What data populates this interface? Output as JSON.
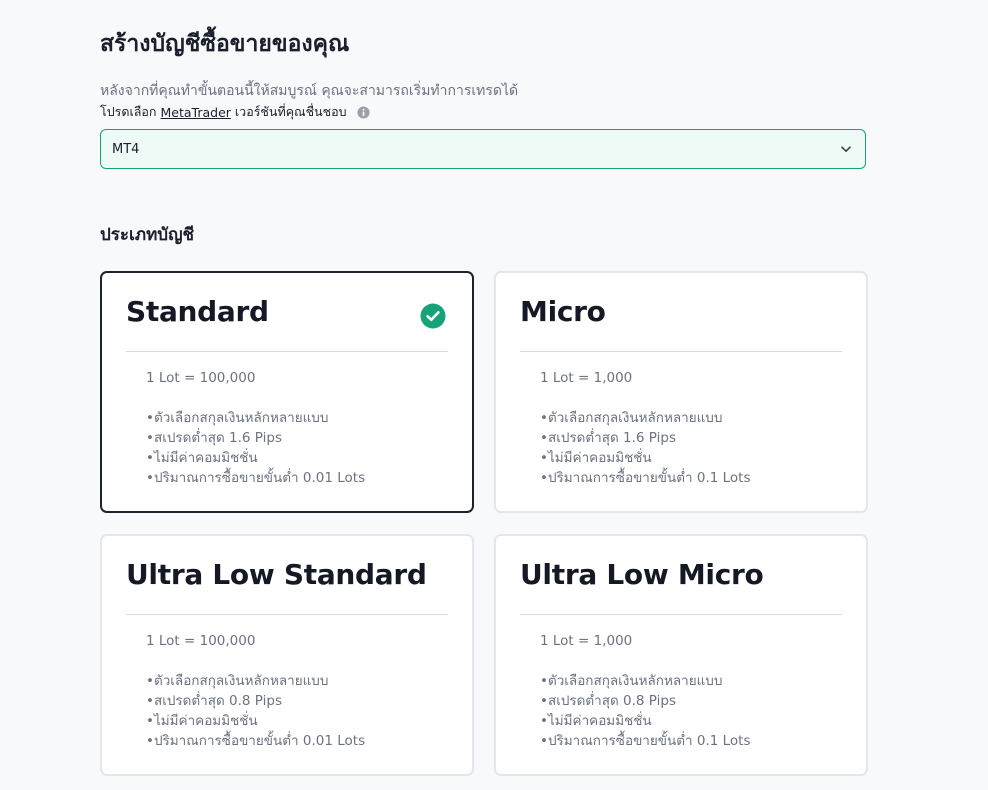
{
  "header": {
    "title": "สร้างบัญชีซื้อขายของคุณ",
    "subtitle": "หลังจากที่คุณทำขั้นตอนนี้ให้สมบูรณ์ คุณจะสามารถเริ่มทำการเทรดได้"
  },
  "platform": {
    "prompt_before": "โปรดเลือก",
    "prompt_link": "MetaTrader",
    "prompt_after": "เวอร์ชันที่คุณชื่นชอบ",
    "info_icon": "info-icon",
    "selected_value": "MT4",
    "dropdown_icon": "chevron-down-icon"
  },
  "account_types": {
    "section_title": "ประเภทบัญชี",
    "selected_icon": "check-circle-icon",
    "colors": {
      "accent": "#16a37a",
      "selected_border": "#1d2230"
    },
    "cards": [
      {
        "name": "Standard",
        "selected": true,
        "lot": "1 Lot = 100,000",
        "features": [
          "•ตัวเลือกสกุลเงินหลักหลายแบบ",
          "•สเปรดต่ำสุด 1.6 Pips",
          "•ไม่มีค่าคอมมิชชั่น",
          "•ปริมาณการซื้อขายขั้นต่ำ 0.01 Lots"
        ]
      },
      {
        "name": "Micro",
        "selected": false,
        "lot": "1 Lot = 1,000",
        "features": [
          "•ตัวเลือกสกุลเงินหลักหลายแบบ",
          "•สเปรดต่ำสุด 1.6 Pips",
          "•ไม่มีค่าคอมมิชชั่น",
          "•ปริมาณการซื้อขายขั้นต่ำ 0.1 Lots"
        ]
      },
      {
        "name": "Ultra Low Standard",
        "selected": false,
        "lot": "1 Lot = 100,000",
        "features": [
          "•ตัวเลือกสกุลเงินหลักหลายแบบ",
          "•สเปรดต่ำสุด 0.8 Pips",
          "•ไม่มีค่าคอมมิชชั่น",
          "•ปริมาณการซื้อขายขั้นต่ำ 0.01 Lots"
        ]
      },
      {
        "name": "Ultra Low Micro",
        "selected": false,
        "lot": "1 Lot = 1,000",
        "features": [
          "•ตัวเลือกสกุลเงินหลักหลายแบบ",
          "•สเปรดต่ำสุด 0.8 Pips",
          "•ไม่มีค่าคอมมิชชั่น",
          "•ปริมาณการซื้อขายขั้นต่ำ 0.1 Lots"
        ]
      }
    ]
  }
}
